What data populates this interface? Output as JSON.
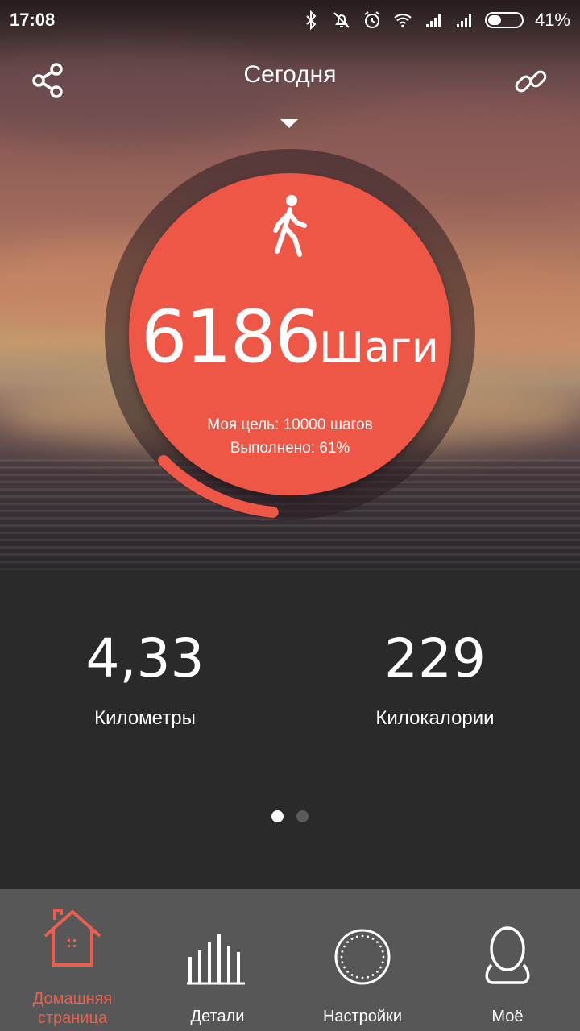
{
  "status_bar": {
    "time": "17:08",
    "battery": "41%",
    "battery_level": 0.41
  },
  "header": {
    "title": "Сегодня"
  },
  "activity": {
    "steps": "6186",
    "steps_unit": "Шаги",
    "goal_text": "Моя цель: 10000 шагов",
    "completed_text": "Выполнено: 61%",
    "progress": 0.61,
    "accent_color": "#ee5646"
  },
  "stats": [
    {
      "value": "4,33",
      "label": "Километры"
    },
    {
      "value": "229",
      "label": "Килокалории"
    }
  ],
  "pager": {
    "pages": 2,
    "active": 0
  },
  "nav": [
    {
      "label_1": "Домашняя",
      "label_2": "страница",
      "icon": "home-icon",
      "active": true
    },
    {
      "label": "Детали",
      "icon": "bar-chart-icon"
    },
    {
      "label": "Настройки",
      "icon": "settings-dial-icon"
    },
    {
      "label": "Моё",
      "icon": "profile-icon"
    }
  ]
}
